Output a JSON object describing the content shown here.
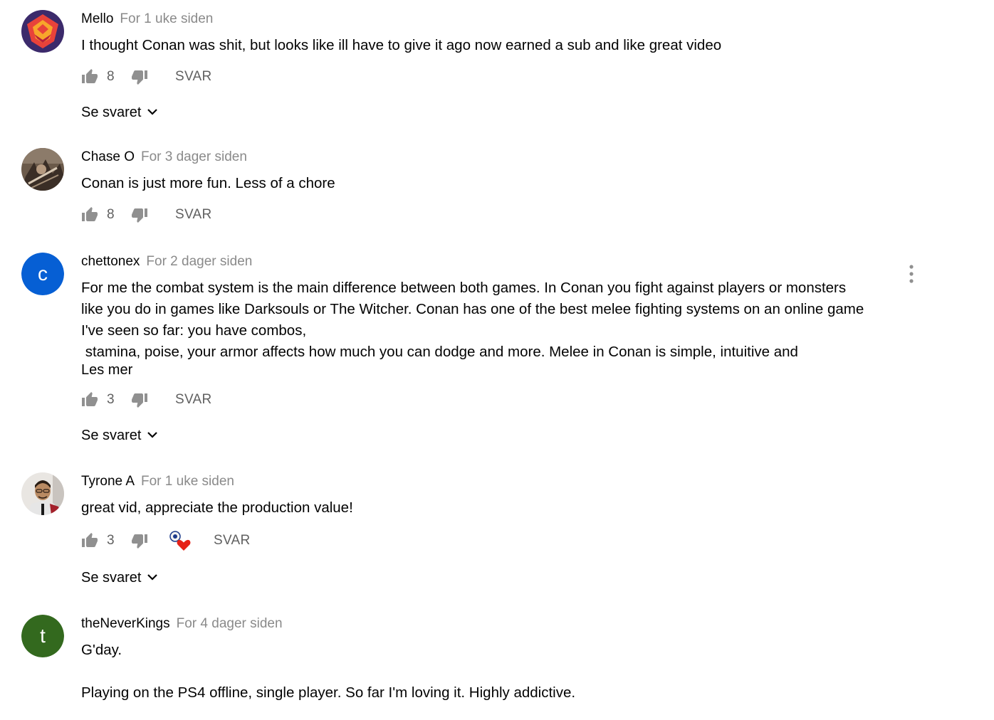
{
  "comments": [
    {
      "author": "Mello",
      "time": "For 1 uke siden",
      "text": [
        "I thought Conan was shit, but looks like ill have to give it ago now earned a sub and like great video"
      ],
      "likes": "8",
      "reply_label": "SVAR",
      "replies_label": "Se svaret",
      "avatar_icon": "colorful-emblem-avatar"
    },
    {
      "author": "Chase O",
      "time": "For 3 dager siden",
      "text": [
        "Conan is just more fun. Less of a chore"
      ],
      "likes": "8",
      "reply_label": "SVAR",
      "avatar_icon": "photo-avatar"
    },
    {
      "author": "chettonex",
      "time": "For 2 dager siden",
      "text": [
        "For me the combat system is the main difference between both games. In Conan you fight against players or monsters",
        "like you do in games like Darksouls or The Witcher. Conan has one of the best melee fighting systems on an online game",
        "I've seen so far: you have combos,",
        " stamina, poise, your armor affects how much you can dodge and more. Melee in Conan is simple, intuitive and"
      ],
      "read_more": "Les mer",
      "likes": "3",
      "reply_label": "SVAR",
      "replies_label": "Se svaret",
      "avatar_letter": "c",
      "avatar_color": "#065fd4"
    },
    {
      "author": "Tyrone A",
      "time": "For 1 uke siden",
      "text": [
        "great vid, appreciate the production value!"
      ],
      "likes": "3",
      "reply_label": "SVAR",
      "replies_label": "Se svaret",
      "creator_heart": true,
      "avatar_icon": "photo-avatar"
    },
    {
      "author": "theNeverKings",
      "time": "For 4 dager siden",
      "text": [
        "G'day.",
        "",
        "Playing on the PS4 offline, single player. So far I'm loving it. Highly addictive."
      ],
      "avatar_letter": "t",
      "avatar_color": "#33691e"
    }
  ],
  "colors": {
    "text": "#030303",
    "secondary": "#606060",
    "timestamp": "#8a8a8a",
    "heart": "#e62117"
  }
}
